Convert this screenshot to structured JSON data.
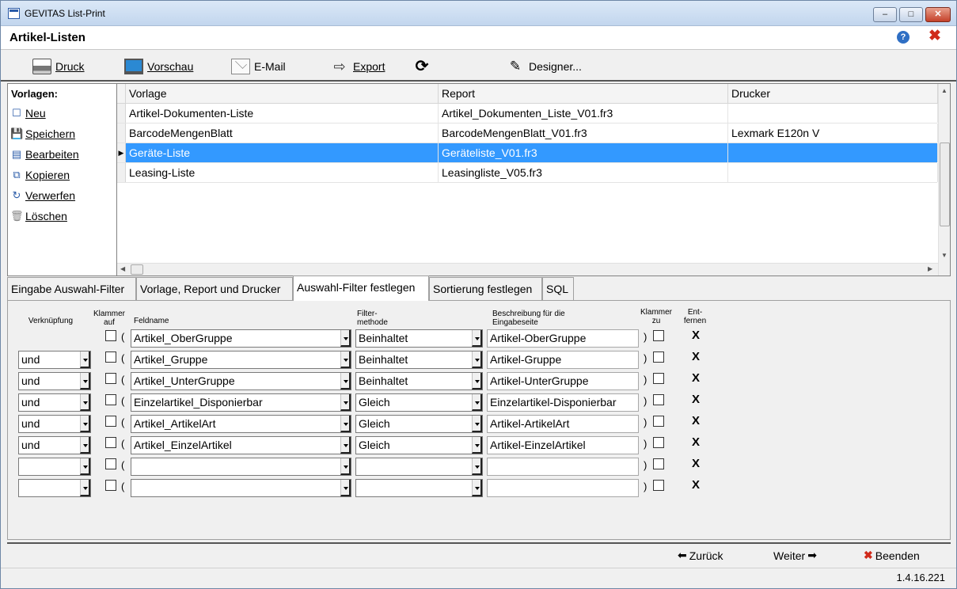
{
  "window": {
    "title": "GEVITAS List-Print",
    "minimize": "–",
    "maximize": "□",
    "close": "✕"
  },
  "header": {
    "title": "Artikel-Listen",
    "help_glyph": "?",
    "close_glyph": "✖"
  },
  "toolbar": {
    "print_label": "Druck",
    "preview_label": "Vorschau",
    "email_label": "E-Mail",
    "export_label": "Export",
    "refresh_glyph": "⟳",
    "designer_label": "Designer...",
    "icons": {
      "print": "printer-icon",
      "preview": "monitor-icon",
      "email": "envelope-icon",
      "export": "export-icon",
      "refresh": "refresh-icon",
      "designer": "designer-icon"
    }
  },
  "sidebar": {
    "heading": "Vorlagen:",
    "items": [
      {
        "label": "Neu",
        "icon": "☐"
      },
      {
        "label": "Speichern",
        "icon": "💾"
      },
      {
        "label": "Bearbeiten",
        "icon": "▤"
      },
      {
        "label": "Kopieren",
        "icon": "⧉"
      },
      {
        "label": "Verwerfen",
        "icon": "↻"
      },
      {
        "label": "Löschen",
        "icon": "🗑"
      }
    ]
  },
  "grid": {
    "columns": [
      "Vorlage",
      "Report",
      "Drucker"
    ],
    "rows": [
      {
        "vorlage": "Artikel-Dokumenten-Liste",
        "report": "Artikel_Dokumenten_Liste_V01.fr3",
        "drucker": ""
      },
      {
        "vorlage": "BarcodeMengenBlatt",
        "report": "BarcodeMengenBlatt_V01.fr3",
        "drucker": "Lexmark E120n V"
      },
      {
        "vorlage": "Geräte-Liste",
        "report": "Geräteliste_V01.fr3",
        "drucker": "",
        "selected": true
      },
      {
        "vorlage": "Leasing-Liste",
        "report": "Leasingliste_V05.fr3",
        "drucker": ""
      }
    ],
    "selected_indicator": "▶"
  },
  "tabs": [
    {
      "label": "Eingabe Auswahl-Filter"
    },
    {
      "label": "Vorlage, Report und Drucker"
    },
    {
      "label": "Auswahl-Filter festlegen",
      "active": true
    },
    {
      "label": "Sortierung festlegen"
    },
    {
      "label": "SQL"
    }
  ],
  "filter": {
    "headers": {
      "verknuepfung": "Verknüpfung",
      "klammer_auf": "Klammer auf",
      "feldname": "Feldname",
      "filtermethode": "Filter- methode",
      "beschreibung": "Beschreibung für die Eingabeseite",
      "klammer_zu": "Klammer zu",
      "entfernen": "Ent- fernen"
    },
    "open_paren": "(",
    "close_paren": ")",
    "remove_glyph": "X",
    "rows": [
      {
        "verknuepfung": null,
        "feld": "Artikel_OberGruppe",
        "methode": "Beinhaltet",
        "beschreibung": "Artikel-OberGruppe"
      },
      {
        "verknuepfung": "und",
        "feld": "Artikel_Gruppe",
        "methode": "Beinhaltet",
        "beschreibung": "Artikel-Gruppe"
      },
      {
        "verknuepfung": "und",
        "feld": "Artikel_UnterGruppe",
        "methode": "Beinhaltet",
        "beschreibung": "Artikel-UnterGruppe"
      },
      {
        "verknuepfung": "und",
        "feld": "Einzelartikel_Disponierbar",
        "methode": "Gleich",
        "beschreibung": "Einzelartikel-Disponierbar"
      },
      {
        "verknuepfung": "und",
        "feld": "Artikel_ArtikelArt",
        "methode": "Gleich",
        "beschreibung": "Artikel-ArtikelArt"
      },
      {
        "verknuepfung": "und",
        "feld": "Artikel_EinzelArtikel",
        "methode": "Gleich",
        "beschreibung": "Artikel-EinzelArtikel"
      },
      {
        "verknuepfung": "",
        "feld": "",
        "methode": "",
        "beschreibung": ""
      },
      {
        "verknuepfung": "",
        "feld": "",
        "methode": "",
        "beschreibung": ""
      }
    ]
  },
  "footer": {
    "back_label": "Zurück",
    "next_label": "Weiter",
    "exit_label": "Beenden",
    "back_glyph": "⬅",
    "next_glyph": "➡",
    "exit_glyph": "✖"
  },
  "status": {
    "version": "1.4.16.221"
  },
  "colors": {
    "selection": "#3399ff",
    "close_red": "#d02a1a",
    "help_blue": "#2f6fc4"
  }
}
